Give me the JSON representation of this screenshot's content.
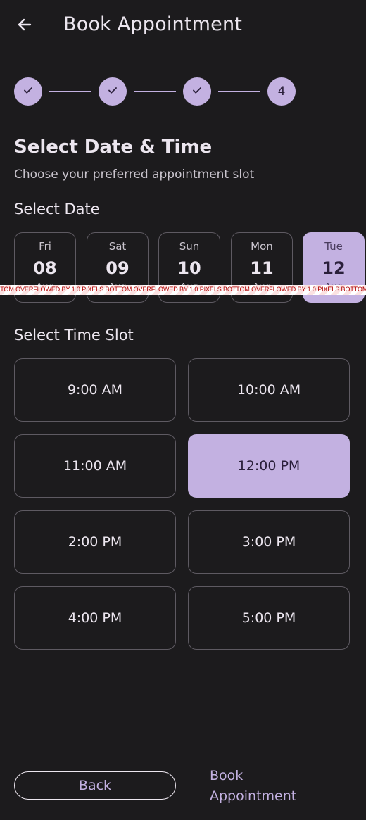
{
  "appbar": {
    "title": "Book Appointment",
    "back_icon": "arrow-left-icon"
  },
  "stepper": {
    "steps": [
      {
        "state": "done",
        "icon": "check-icon"
      },
      {
        "state": "done",
        "icon": "check-icon"
      },
      {
        "state": "done",
        "icon": "check-icon"
      },
      {
        "state": "current",
        "label": "4"
      }
    ]
  },
  "header": {
    "title": "Select Date & Time",
    "subtitle": "Choose your preferred appointment slot"
  },
  "date_section": {
    "label": "Select Date",
    "dates": [
      {
        "dow": "Fri",
        "day": "08",
        "month": "Aug"
      },
      {
        "dow": "Sat",
        "day": "09",
        "month": "Aug"
      },
      {
        "dow": "Sun",
        "day": "10",
        "month": "Aug"
      },
      {
        "dow": "Mon",
        "day": "11",
        "month": "Aug"
      },
      {
        "dow": "Tue",
        "day": "12",
        "month": "Aug",
        "selected": true
      }
    ],
    "overflow_warning": "BOTTOM OVERFLOWED BY 1.0 PIXELS"
  },
  "time_section": {
    "label": "Select Time Slot",
    "slots": [
      {
        "label": "9:00 AM"
      },
      {
        "label": "10:00 AM"
      },
      {
        "label": "11:00 AM"
      },
      {
        "label": "12:00 PM",
        "selected": true
      },
      {
        "label": "2:00 PM"
      },
      {
        "label": "3:00 PM"
      },
      {
        "label": "4:00 PM"
      },
      {
        "label": "5:00 PM"
      }
    ]
  },
  "footer": {
    "back_label": "Back",
    "book_label": "Book Appointment"
  },
  "colors": {
    "background": "#1c1b1d",
    "accent": "#c3b1e1",
    "text": "#ece6ef",
    "border": "#5e5a62"
  }
}
